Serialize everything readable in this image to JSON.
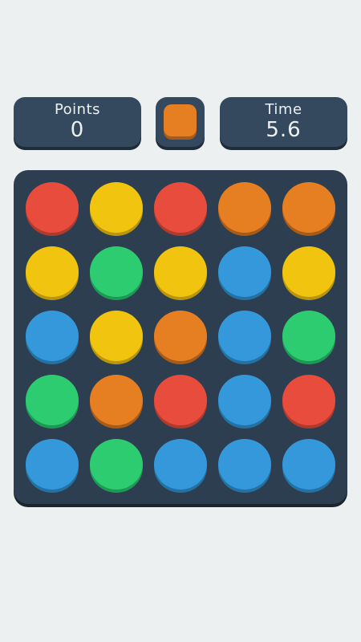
{
  "header": {
    "points_label": "Points",
    "points_value": "0",
    "time_label": "Time",
    "time_value": "5.6",
    "target_color": "orange"
  },
  "colors": {
    "red": {
      "fill": "#e74c3c",
      "shadow": "#b03a2e"
    },
    "yellow": {
      "fill": "#f1c40f",
      "shadow": "#b8950a"
    },
    "orange": {
      "fill": "#e67e22",
      "shadow": "#a85a16"
    },
    "blue": {
      "fill": "#3498db",
      "shadow": "#2471a3"
    },
    "green": {
      "fill": "#2ecc71",
      "shadow": "#1e9955"
    }
  },
  "board": {
    "rows": [
      [
        "red",
        "yellow",
        "red",
        "orange",
        "orange"
      ],
      [
        "yellow",
        "green",
        "yellow",
        "blue",
        "yellow"
      ],
      [
        "blue",
        "yellow",
        "orange",
        "blue",
        "green"
      ],
      [
        "green",
        "orange",
        "red",
        "blue",
        "red"
      ],
      [
        "blue",
        "green",
        "blue",
        "blue",
        "blue"
      ]
    ]
  }
}
